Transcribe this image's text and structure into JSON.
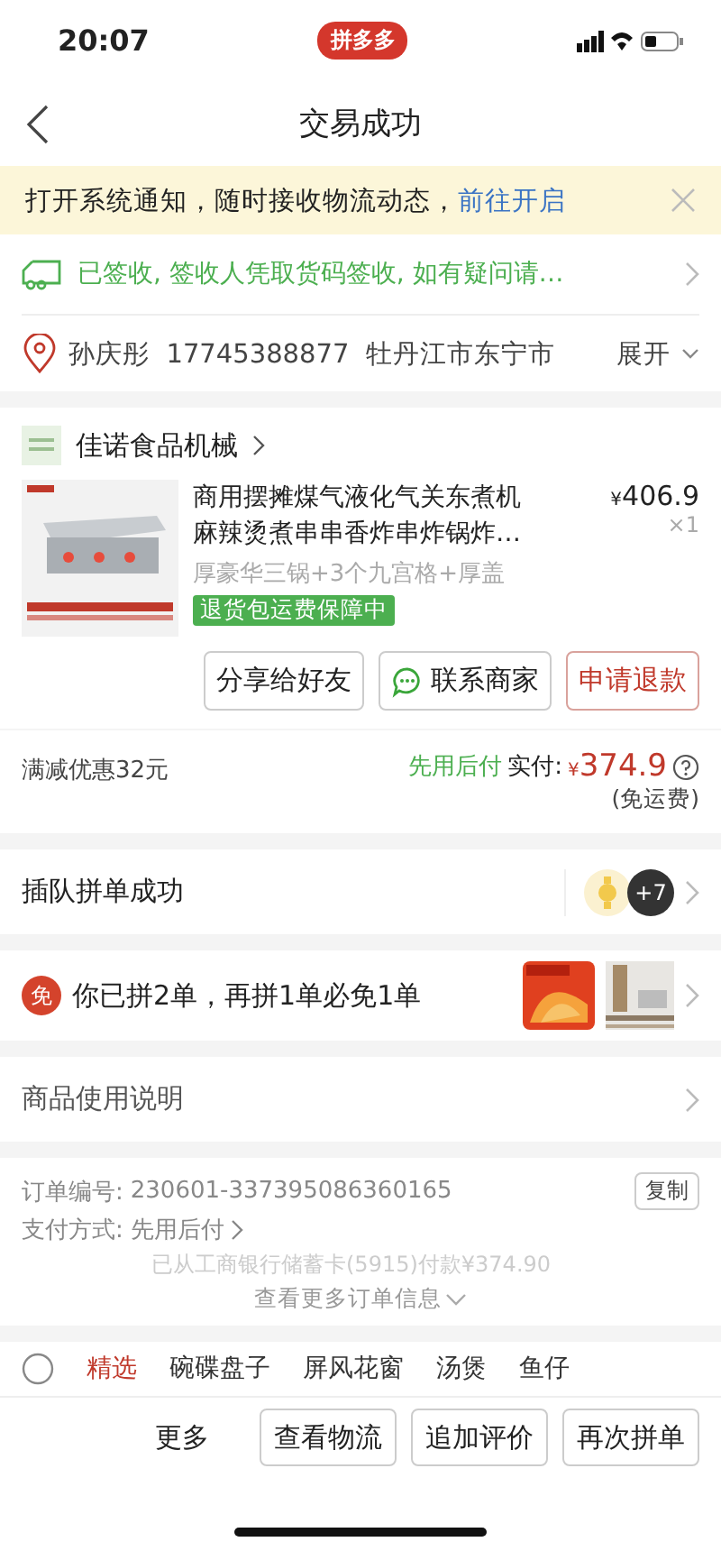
{
  "status_bar": {
    "time": "20:07",
    "app_badge": "拼多多"
  },
  "nav": {
    "title": "交易成功"
  },
  "notice": {
    "text": "打开系统通知，随时接收物流动态，",
    "link": "前往开启"
  },
  "delivery": {
    "text": "已签收, 签收人凭取货码签收, 如有疑问请…"
  },
  "address": {
    "name": "孙庆彤",
    "phone": "17745388877",
    "address": "牡丹江市东宁市",
    "expand": "展开"
  },
  "shop": {
    "name": "佳诺食品机械"
  },
  "product": {
    "title_lines": [
      "商用摆摊煤气液化气关东煮机",
      "麻辣烫煮串串香炸串炸锅炸…"
    ],
    "spec": "厚豪华三锅+3个九宫格+厚盖",
    "price": "406.9",
    "currency": "¥",
    "quantity": "×1",
    "guarantee": "退货包运费保障中"
  },
  "actions": [
    {
      "label": "分享给好友",
      "kind": "plain"
    },
    {
      "label": "联系商家",
      "kind": "chat"
    },
    {
      "label": "申请退款",
      "kind": "danger"
    }
  ],
  "summary": {
    "discount": "满减优惠32元",
    "pay_later": "先用后付",
    "paid_label": "实付:",
    "currency": "¥",
    "amount": "374.9",
    "shipping": "(免运费)"
  },
  "group": {
    "text": "插队拼单成功",
    "more_count": "+7"
  },
  "free": {
    "badge": "免",
    "text": "你已拼2单，再拼1单必免1单"
  },
  "manual": {
    "text": "商品使用说明"
  },
  "info": {
    "order_label": "订单编号:",
    "order_no": "230601-337395086360165",
    "copy": "复制",
    "pay_label": "支付方式:",
    "pay_value": "先用后付",
    "paid_note": "已从工商银行储蓄卡(5915)付款¥374.90",
    "more": "查看更多订单信息"
  },
  "tabs": [
    {
      "label": "精选",
      "selected": true
    },
    {
      "label": "碗碟盘子",
      "selected": false
    },
    {
      "label": "屏风花窗",
      "selected": false
    },
    {
      "label": "汤煲",
      "selected": false
    },
    {
      "label": "鱼仔",
      "selected": false
    }
  ],
  "bottom": {
    "more": "更多",
    "buttons": [
      "查看物流",
      "追加评价",
      "再次拼单"
    ]
  }
}
